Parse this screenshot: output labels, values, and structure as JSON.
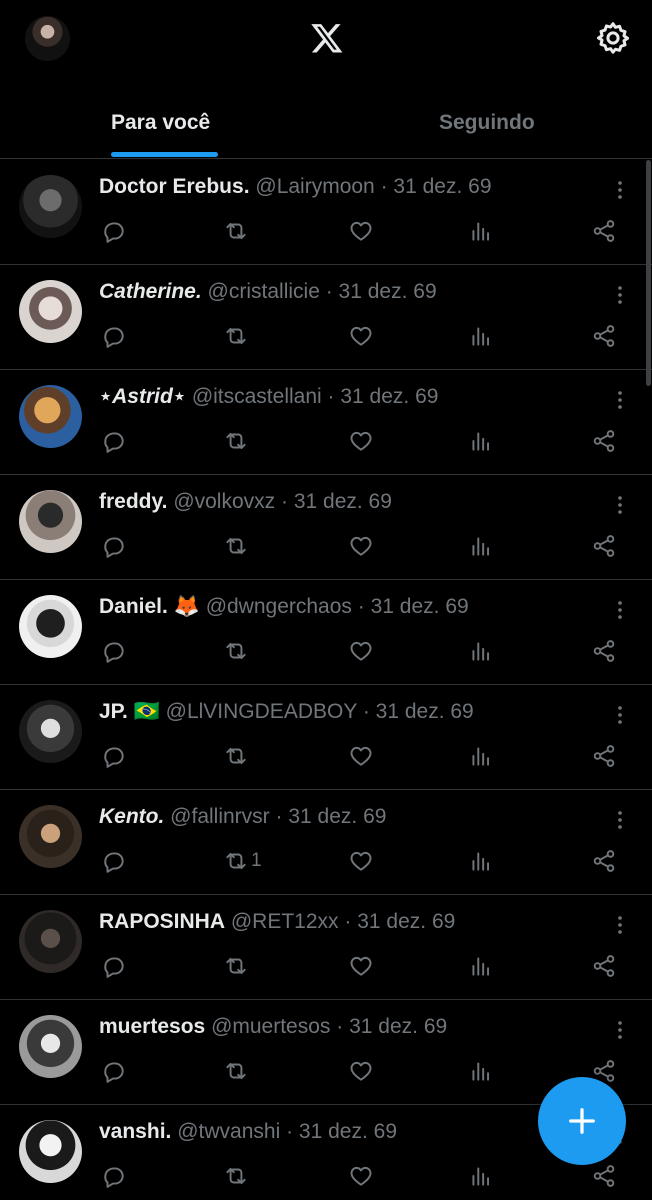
{
  "header": {
    "logo": "x-logo",
    "settings_icon": "gear-icon"
  },
  "tabs": [
    {
      "label": "Para você",
      "active": true
    },
    {
      "label": "Seguindo",
      "active": false
    }
  ],
  "colors": {
    "accent": "#1d9bf0",
    "text": "#e7e9ea",
    "muted": "#71767b",
    "divider": "#2f3336",
    "background": "#000000"
  },
  "feed": [
    {
      "name": "Doctor Erebus.",
      "handle": "@Lairymoon",
      "meta": "· 31 dez. 69",
      "retweets": ""
    },
    {
      "name": "Catherine.",
      "handle": "@cristallicie",
      "meta": "· 31 dez. 69",
      "retweets": ""
    },
    {
      "name": "⋆Astrid⋆",
      "handle": "@itscastellani",
      "meta": "· 31 dez. 69",
      "retweets": ""
    },
    {
      "name": "freddy.",
      "handle": "@volkovxz",
      "meta": "· 31 dez. 69",
      "retweets": ""
    },
    {
      "name": "Daniel. 🦊",
      "handle": "@dwngerchaos",
      "meta": "· 31 dez. 69",
      "retweets": ""
    },
    {
      "name": "JP. 🇧🇷",
      "handle": "@LlVINGDEADBOY",
      "meta": "· 31 dez. 69",
      "retweets": ""
    },
    {
      "name": "Kento.",
      "handle": "@fallinrvsr",
      "meta": "· 31 dez. 69",
      "retweets": "1"
    },
    {
      "name": "RAPOSINHA",
      "handle": "@RET12xx",
      "meta": "· 31 dez. 69",
      "retweets": ""
    },
    {
      "name": "muertesos",
      "handle": "@muertesos",
      "meta": "· 31 dez. 69",
      "retweets": ""
    },
    {
      "name": "vanshi.",
      "handle": "@twvanshi",
      "meta": "· 31 dez. 69",
      "retweets": ""
    }
  ],
  "actions": {
    "reply_icon": "reply-icon",
    "retweet_icon": "retweet-icon",
    "like_icon": "heart-icon",
    "views_icon": "views-icon",
    "share_icon": "share-icon"
  },
  "compose": {
    "icon": "plus-icon"
  }
}
